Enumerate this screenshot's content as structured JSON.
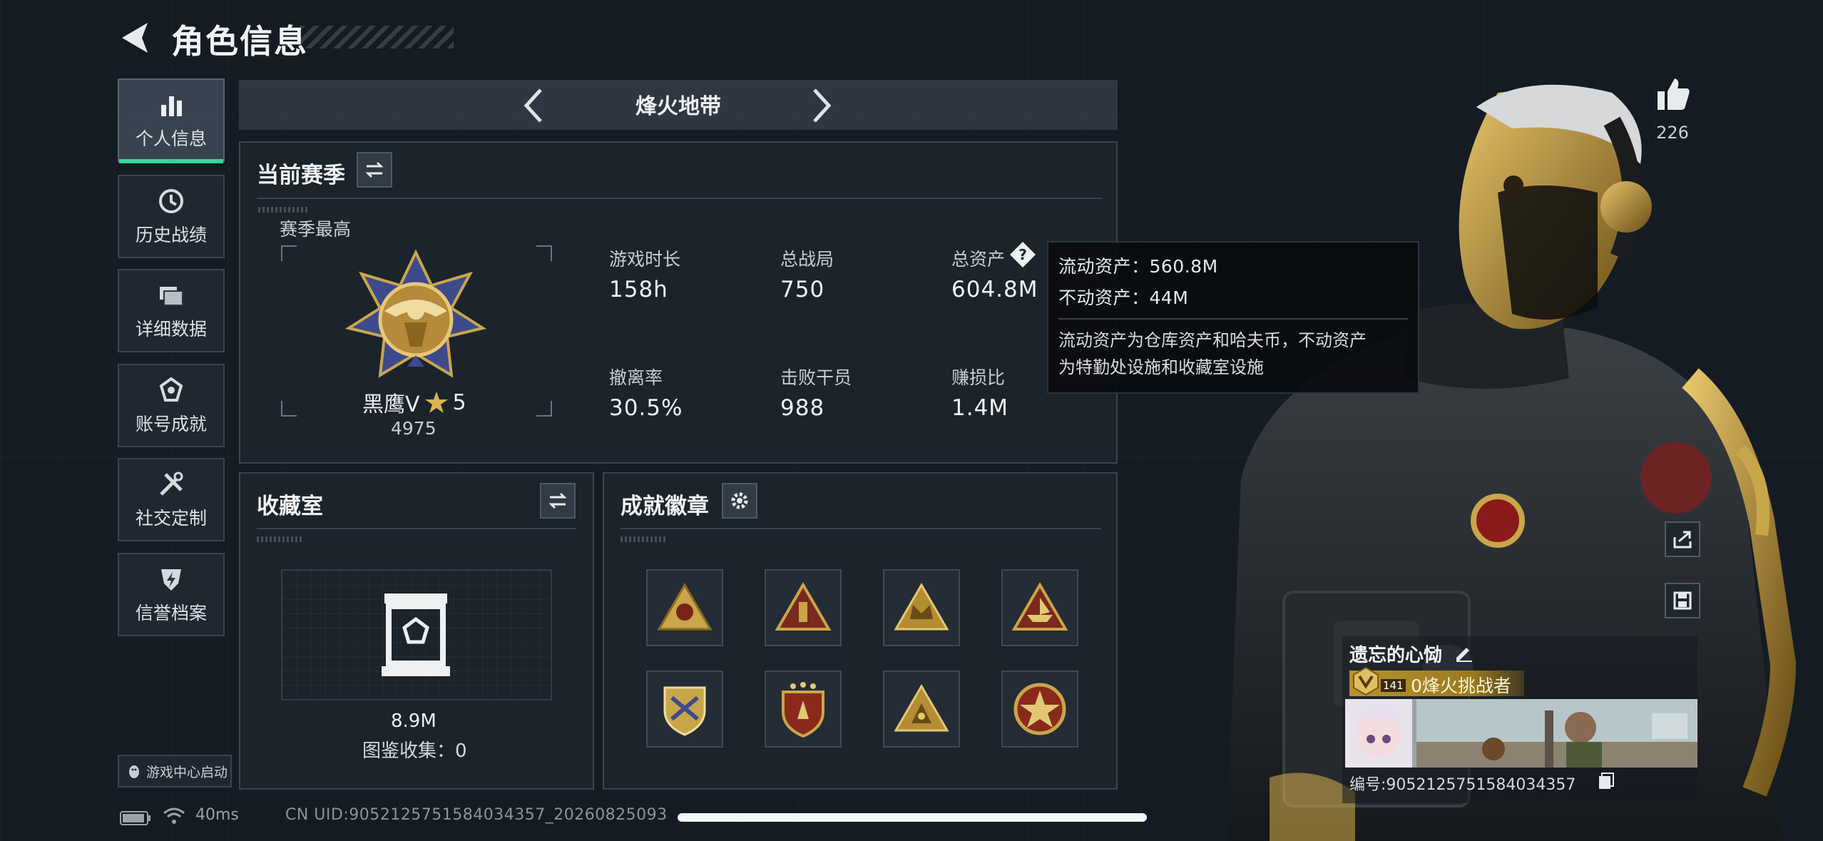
{
  "header": {
    "title": "角色信息"
  },
  "nav": {
    "items": [
      {
        "label": "个人信息",
        "icon": "bar-chart-icon"
      },
      {
        "label": "历史战绩",
        "icon": "history-clock-icon"
      },
      {
        "label": "详细数据",
        "icon": "folders-icon"
      },
      {
        "label": "账号成就",
        "icon": "medal-icon"
      },
      {
        "label": "社交定制",
        "icon": "tools-icon"
      },
      {
        "label": "信誉档案",
        "icon": "shield-lightning-icon"
      }
    ],
    "game_center_label": "游戏中心启动"
  },
  "mode": {
    "title": "烽火地带"
  },
  "season": {
    "title": "当前赛季",
    "best_label": "赛季最高",
    "rank_name": "黑鹰V",
    "rank_stars": "5",
    "rank_score": "4975",
    "stats": [
      {
        "label": "游戏时长",
        "value": "158h"
      },
      {
        "label": "总战局",
        "value": "750"
      },
      {
        "label": "总资产",
        "value": "604.8M"
      },
      {
        "label": "撤离率",
        "value": "30.5%"
      },
      {
        "label": "击败干员",
        "value": "988"
      },
      {
        "label": "赚损比",
        "value": "1.4M"
      }
    ]
  },
  "tooltip": {
    "liquid": "流动资产：560.8M",
    "fixed": "不动资产：44M",
    "desc_line1": "流动资产为仓库资产和哈夫币，不动资产",
    "desc_line2": "为特勤处设施和收藏室设施"
  },
  "collection": {
    "title": "收藏室",
    "value": "8.9M",
    "catalog": "图鉴收集：0"
  },
  "badges": {
    "title": "成就徽章",
    "items": [
      {
        "name": "badge-fist-triangle"
      },
      {
        "name": "badge-bottle-triangle"
      },
      {
        "name": "badge-crown-triangle"
      },
      {
        "name": "badge-boat-triangle"
      },
      {
        "name": "badge-shield-gold"
      },
      {
        "name": "badge-shield-stars"
      },
      {
        "name": "badge-eye-triangle"
      },
      {
        "name": "badge-round-star"
      }
    ]
  },
  "profile": {
    "likes": "226",
    "name": "遗忘的心恸",
    "level": "141",
    "rank_title": "0烽火挑战者",
    "id": "编号:9052125751584034357"
  },
  "status": {
    "ping": "40ms",
    "uid": "CN UID:9052125751584034357_20260825093"
  },
  "colors": {
    "accent_green": "#35d49a",
    "gold": "#c9a64a",
    "panel_bg": "#1c242c"
  }
}
